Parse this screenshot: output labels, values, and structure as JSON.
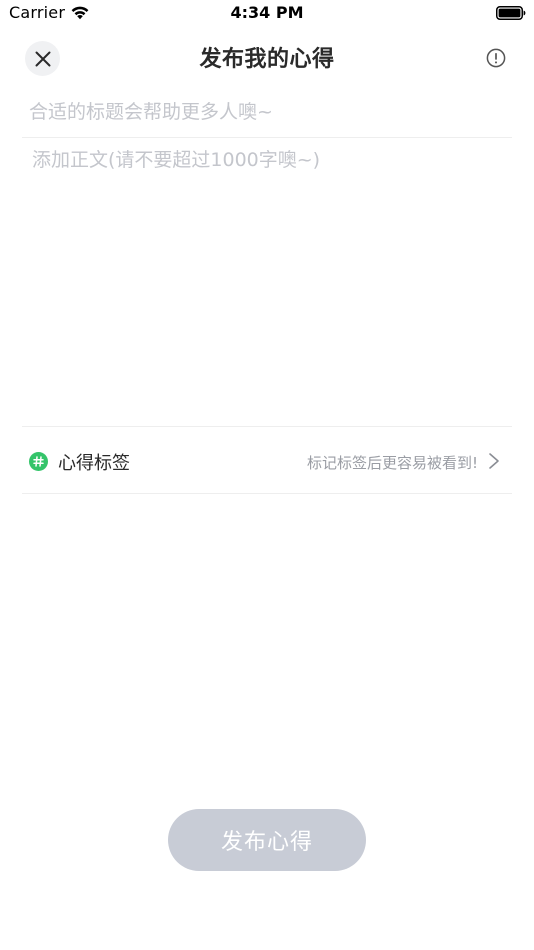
{
  "status_bar": {
    "carrier": "Carrier",
    "time": "4:34 PM"
  },
  "header": {
    "title": "发布我的心得",
    "close_icon": "close-icon",
    "info_icon": "info-icon"
  },
  "form": {
    "title_placeholder": "合适的标题会帮助更多人噢~",
    "title_value": "",
    "body_placeholder": "添加正文(请不要超过1000字噢~)",
    "body_value": ""
  },
  "tag_row": {
    "label": "心得标签",
    "hint": "标记标签后更容易被看到!",
    "icon": "hash-icon",
    "accent_color": "#34c46a"
  },
  "publish": {
    "label": "发布心得",
    "button_color": "#c8ccd6"
  }
}
